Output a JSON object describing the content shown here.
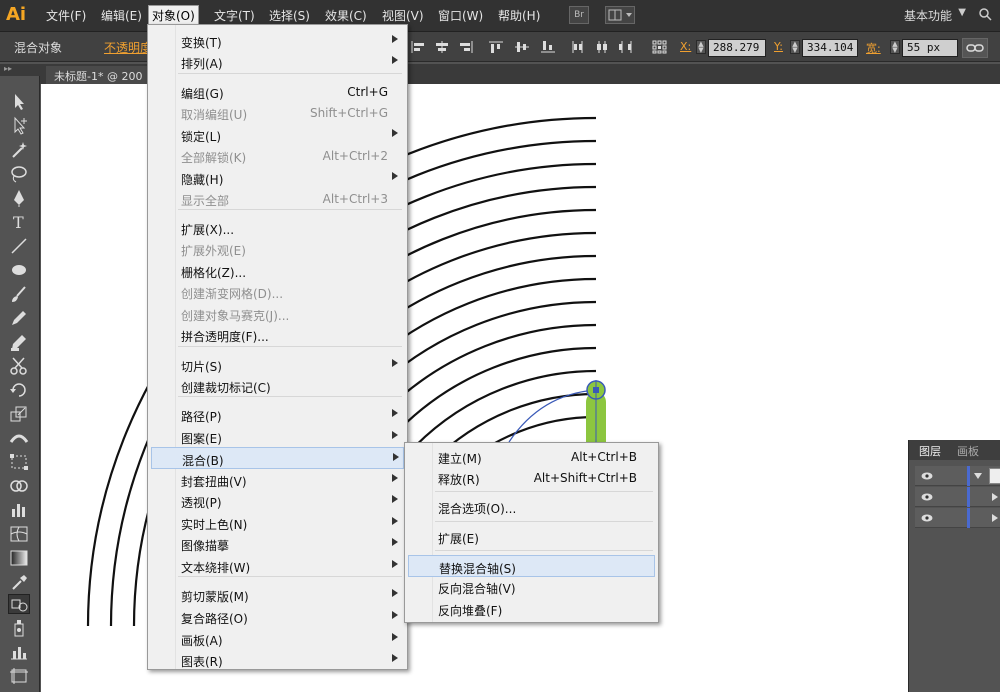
{
  "app": {
    "logo": "Ai"
  },
  "menubar": {
    "items": [
      "文件(F)",
      "编辑(E)",
      "对象(O)",
      "文字(T)",
      "选择(S)",
      "效果(C)",
      "视图(V)",
      "窗口(W)",
      "帮助(H)"
    ],
    "br_button": "Br",
    "workspace": "基本功能"
  },
  "controlbar": {
    "selection_label": "混合对象",
    "opacity_label": "不透明度",
    "x_label": "X:",
    "x_value": "288.279",
    "y_label": "Y:",
    "y_value": "334.104",
    "w_label": "宽:",
    "w_value": "55 px"
  },
  "document": {
    "tab_title": "未标题-1* @ 200"
  },
  "object_menu": {
    "items": [
      {
        "label": "变换(T)",
        "shortcut": "",
        "submenu": true,
        "disabled": false
      },
      {
        "label": "排列(A)",
        "shortcut": "",
        "submenu": true,
        "disabled": false
      },
      {
        "label": "编组(G)",
        "shortcut": "Ctrl+G",
        "submenu": false,
        "disabled": false
      },
      {
        "label": "取消编组(U)",
        "shortcut": "Shift+Ctrl+G",
        "submenu": false,
        "disabled": true
      },
      {
        "label": "锁定(L)",
        "shortcut": "",
        "submenu": true,
        "disabled": false
      },
      {
        "label": "全部解锁(K)",
        "shortcut": "Alt+Ctrl+2",
        "submenu": false,
        "disabled": true
      },
      {
        "label": "隐藏(H)",
        "shortcut": "",
        "submenu": true,
        "disabled": false
      },
      {
        "label": "显示全部",
        "shortcut": "Alt+Ctrl+3",
        "submenu": false,
        "disabled": true
      },
      {
        "label": "扩展(X)...",
        "shortcut": "",
        "submenu": false,
        "disabled": false
      },
      {
        "label": "扩展外观(E)",
        "shortcut": "",
        "submenu": false,
        "disabled": true
      },
      {
        "label": "栅格化(Z)...",
        "shortcut": "",
        "submenu": false,
        "disabled": false
      },
      {
        "label": "创建渐变网格(D)...",
        "shortcut": "",
        "submenu": false,
        "disabled": true
      },
      {
        "label": "创建对象马赛克(J)...",
        "shortcut": "",
        "submenu": false,
        "disabled": true
      },
      {
        "label": "拼合透明度(F)...",
        "shortcut": "",
        "submenu": false,
        "disabled": false
      },
      {
        "label": "切片(S)",
        "shortcut": "",
        "submenu": true,
        "disabled": false
      },
      {
        "label": "创建裁切标记(C)",
        "shortcut": "",
        "submenu": false,
        "disabled": false
      },
      {
        "label": "路径(P)",
        "shortcut": "",
        "submenu": true,
        "disabled": false
      },
      {
        "label": "图案(E)",
        "shortcut": "",
        "submenu": true,
        "disabled": false
      },
      {
        "label": "混合(B)",
        "shortcut": "",
        "submenu": true,
        "disabled": false
      },
      {
        "label": "封套扭曲(V)",
        "shortcut": "",
        "submenu": true,
        "disabled": false
      },
      {
        "label": "透视(P)",
        "shortcut": "",
        "submenu": true,
        "disabled": false
      },
      {
        "label": "实时上色(N)",
        "shortcut": "",
        "submenu": true,
        "disabled": false
      },
      {
        "label": "图像描摹",
        "shortcut": "",
        "submenu": true,
        "disabled": false
      },
      {
        "label": "文本绕排(W)",
        "shortcut": "",
        "submenu": true,
        "disabled": false
      },
      {
        "label": "剪切蒙版(M)",
        "shortcut": "",
        "submenu": true,
        "disabled": false
      },
      {
        "label": "复合路径(O)",
        "shortcut": "",
        "submenu": true,
        "disabled": false
      },
      {
        "label": "画板(A)",
        "shortcut": "",
        "submenu": true,
        "disabled": false
      },
      {
        "label": "图表(R)",
        "shortcut": "",
        "submenu": true,
        "disabled": false
      }
    ]
  },
  "blend_submenu": {
    "items": [
      {
        "label": "建立(M)",
        "shortcut": "Alt+Ctrl+B"
      },
      {
        "label": "释放(R)",
        "shortcut": "Alt+Shift+Ctrl+B"
      },
      {
        "label": "混合选项(O)...",
        "shortcut": ""
      },
      {
        "label": "扩展(E)",
        "shortcut": ""
      },
      {
        "label": "替换混合轴(S)",
        "shortcut": ""
      },
      {
        "label": "反向混合轴(V)",
        "shortcut": ""
      },
      {
        "label": "反向堆叠(F)",
        "shortcut": ""
      }
    ]
  },
  "layers_panel": {
    "tabs": [
      "图层",
      "画板"
    ]
  },
  "colors": {
    "accent_orange": "#f0a030",
    "highlight": "#dde8f6",
    "blend_green": "#8cc63f",
    "selection_blue": "#4a6ad0"
  }
}
